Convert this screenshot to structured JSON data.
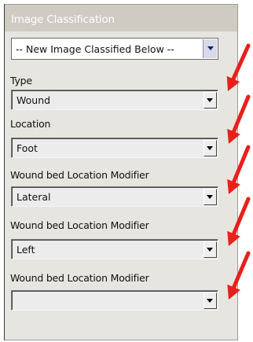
{
  "panel": {
    "title": "Image Classification",
    "selector": {
      "value": "-- New Image Classified Below --"
    },
    "fields": [
      {
        "label": "Type",
        "value": "Wound"
      },
      {
        "label": "Location",
        "value": "Foot"
      },
      {
        "label": "Wound bed Location Modifier",
        "value": "Lateral"
      },
      {
        "label": "Wound bed Location Modifier",
        "value": "Left"
      },
      {
        "label": "Wound bed Location Modifier",
        "value": ""
      }
    ]
  },
  "annotation": {
    "arrow_color": "#e8201c"
  }
}
